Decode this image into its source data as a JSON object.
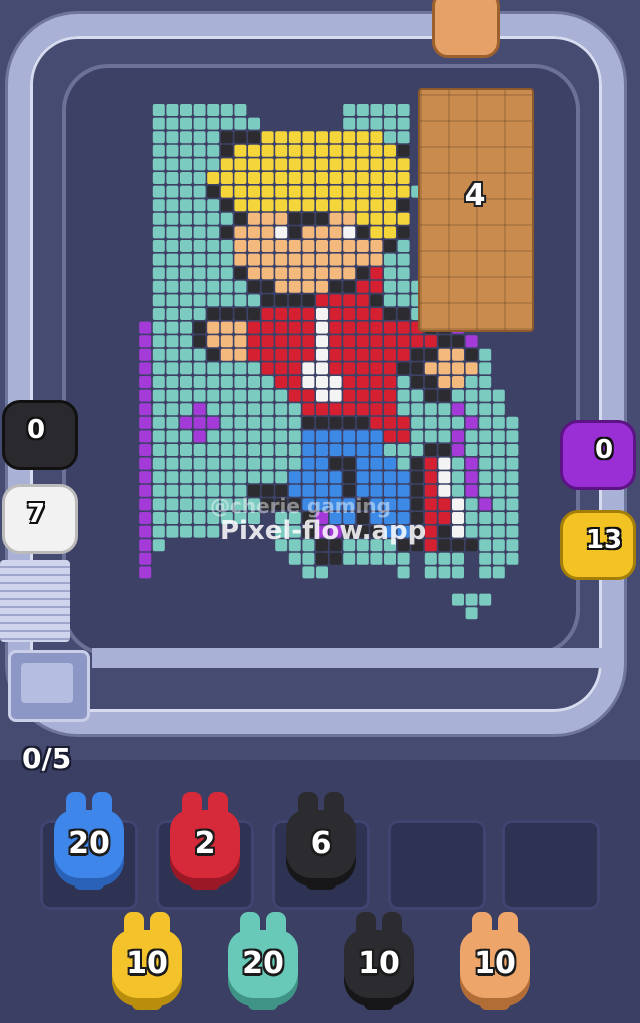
{
  "game": {
    "title": "Pixel Flow",
    "watermark_handle": "@cherie gaming",
    "watermark_site": "Pixel-flow.app",
    "collected_counter": "0/5"
  },
  "board": {
    "crate_count": "4"
  },
  "shooters": [
    {
      "id": "left-black",
      "value": "0",
      "color": "#2a2a2e"
    },
    {
      "id": "left-white",
      "value": "7",
      "color": "#f2f2f2"
    },
    {
      "id": "right-purple",
      "value": "0",
      "color": "#9b2fd6"
    },
    {
      "id": "right-yellow",
      "value": "13",
      "color": "#f2c323"
    }
  ],
  "slots": [
    {
      "value": "20",
      "color": "#3f86ea",
      "filled": true
    },
    {
      "value": "2",
      "color": "#d62a3a",
      "filled": true
    },
    {
      "value": "6",
      "color": "#2c2c30",
      "filled": true
    },
    {
      "value": "",
      "color": "",
      "filled": false
    },
    {
      "value": "",
      "color": "",
      "filled": false
    }
  ],
  "queue": [
    {
      "value": "10",
      "color": "#f4c22a"
    },
    {
      "value": "20",
      "color": "#69c9b8"
    },
    {
      "value": "10",
      "color": "#2c2c30"
    },
    {
      "value": "10",
      "color": "#eea56a"
    }
  ],
  "pixel_art": {
    "palette": {
      ".": null,
      "t": "#7ccbc0",
      "y": "#f5d63a",
      "k": "#2c2c30",
      "s": "#f4b97c",
      "r": "#d42030",
      "w": "#f4f4f4",
      "b": "#3d8ae6",
      "p": "#a43bd8",
      "l": "#9fd9ff"
    },
    "rows": [
      "...ttttttt.......ttttt........",
      "...tttttttt......ttttt........",
      "...tttttkkkyyyyyyyyytt........",
      "...tttttkyyyyyyyyyyyyk........",
      "...tttttyyyyyyyyyyyyyy........",
      "...ttttyyyyyyyyyyyyyyy........",
      "...ttttkyyyyyyyyyyyyyyt.......",
      "...tttttkyyyyyyyyyyyyk........",
      "...ttttttkssskkkssyyyy........",
      "...tttttkssswkssswkyyk........",
      "...ttttttssssssssssskt........",
      "...ttttttssssssssssstt........",
      "...ttttttksssssssskrtt........",
      "...tttttttkksssskkrrttt.......",
      "...ttttttttkkkkrrrrkttt.......",
      "...ttttkkkkrrrrwrrrrkkttt.....",
      "..ptttksssrrrrrwrrrrrrrkkp....",
      "..ptttksssrrrrrwrrrrrrrrkkp...",
      "..pttttkssrrrrrwrrrrrrkksskt..",
      "..pttttttttrrrwwrrrrrkksssst..",
      "..ptttttttttrrwwwrrrrtkksstt..",
      "..pttttttttttrrwwrrrrttkktttt.",
      "..ptttptttttttrrrrrrrttttpttt.",
      "..pttpppttttttkkkkkrrrttttpttt",
      "..ptttptttttttbbbbbbrrtttptttt",
      "..ptttttttttttbbbbbbtttkkptttt",
      "..ptttttttttttbbkkbbbtkrwtpttt",
      "..pttttttttttbbbbkbbbbkrwtpttt",
      "..ptttttttkkkbbbbkbbbbkrwtpttt",
      "..pttttttttkkkbbbbkbbbkrrwtptt",
      "..ptttttttt.ttkpbbkbbbkrrwtttt",
      "..pttttt....ttkppkkkbbkrkwtttt",
      "..pt........tttkkttttkkrkkkttt",
      "..p..........ttkkttttt.ttt.ttt",
      "..p...........tt.....t.ttt.tt.",
      "..............................",
      ".........................ttt..",
      "..........................t..."
    ]
  }
}
